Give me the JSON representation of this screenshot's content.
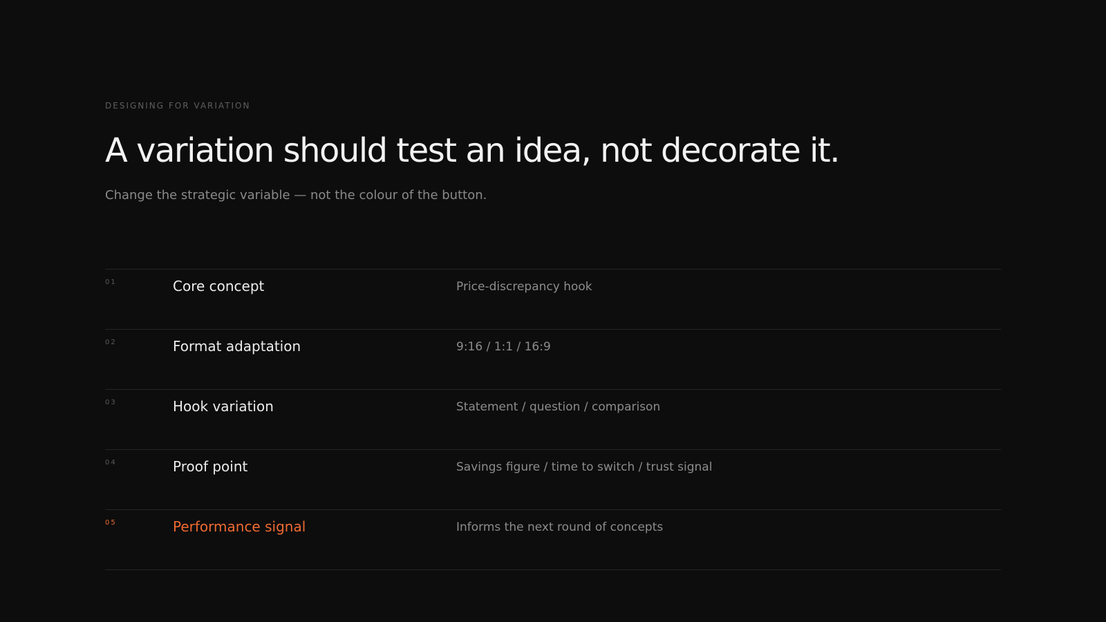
{
  "eyebrow": "DESIGNING FOR VARIATION",
  "headline": "A variation should test an idea, not decorate it.",
  "subhead": "Change the strategic variable — not the colour of the button.",
  "accent_color": "#ef6a32",
  "rows": [
    {
      "number": "01",
      "label": "Core concept",
      "description": "Price-discrepancy hook"
    },
    {
      "number": "02",
      "label": "Format adaptation",
      "description": "9:16 / 1:1 / 16:9"
    },
    {
      "number": "03",
      "label": "Hook variation",
      "description": "Statement / question / comparison"
    },
    {
      "number": "04",
      "label": "Proof point",
      "description": "Savings figure / time to switch / trust signal"
    },
    {
      "number": "05",
      "label": "Performance signal",
      "description": "Informs the next round of concepts",
      "highlighted": true
    }
  ]
}
